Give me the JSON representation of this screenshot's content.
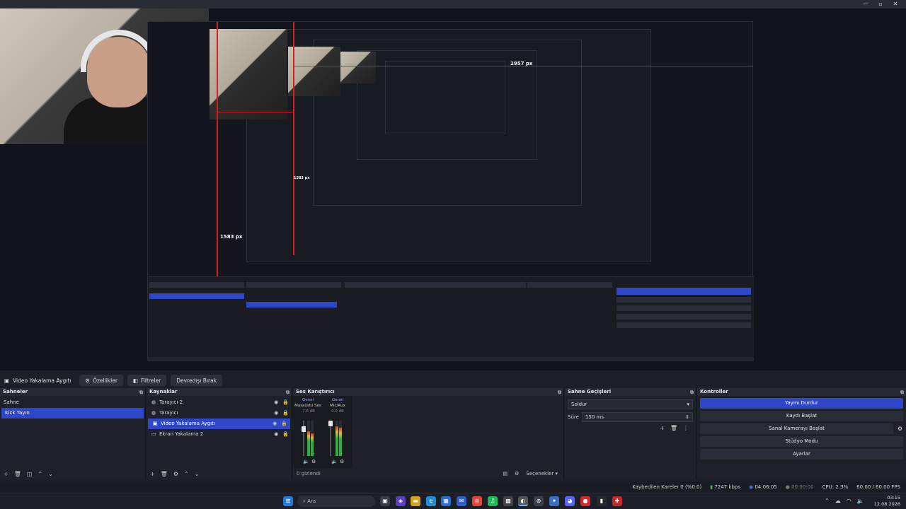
{
  "toolbar": {
    "source_label": "Video Yakalama Aygıtı",
    "properties_label": "Özellikler",
    "filters_label": "Filtreler",
    "deactivate_label": "Devredışı Bırak"
  },
  "preview": {
    "width_label": "2957 px",
    "height_label": "1583 px",
    "inner_height_label": "1583 px"
  },
  "scenes": {
    "title": "Sahneler",
    "items": [
      {
        "label": "Sahne"
      },
      {
        "label": "Kick Yayın"
      }
    ]
  },
  "sources": {
    "title": "Kaynaklar",
    "items": [
      {
        "label": "Tarayıcı 2"
      },
      {
        "label": "Tarayıcı"
      },
      {
        "label": "Video Yakalama Aygıtı"
      },
      {
        "label": "Ekran Yakalama 2"
      }
    ]
  },
  "mixer": {
    "title": "Ses Karıştırıcı",
    "channels": [
      {
        "name": "Genel",
        "device": "Masaüstü Ses",
        "db": "-7.6 dB",
        "level": 0.7
      },
      {
        "name": "Genel",
        "device": "Mic/Aux",
        "db": "0.0 dB",
        "level": 0.85
      }
    ],
    "hidden_count": "0 gizlendi",
    "options_label": "Seçenekler"
  },
  "transitions": {
    "title": "Sahne Geçişleri",
    "selected": "Soldur",
    "duration_label": "Süre",
    "duration_value": "150 ms"
  },
  "controls": {
    "title": "Kontroller",
    "buttons": [
      {
        "label": "Yayını Durdur"
      },
      {
        "label": "Kaydı Başlat"
      },
      {
        "label": "Sanal Kamerayı Başlat"
      },
      {
        "label": "Stüdyo Modu"
      },
      {
        "label": "Ayarlar"
      }
    ]
  },
  "status": {
    "dropped": "Kaybedilen Kareler 0 (%0.0)",
    "bitrate": "7247 kbps",
    "stream_time": "04:06:05",
    "record_time": "00:00:00",
    "cpu": "CPU: 2.3%",
    "fps": "60.00 / 60.00 FPS"
  },
  "taskbar": {
    "search_placeholder": "Ara",
    "time": "03:15",
    "date": "12.08.2026"
  },
  "colors": {
    "accent": "#2e47c9",
    "meter_green": "#2fae3f",
    "bg": "#1d1f26"
  }
}
